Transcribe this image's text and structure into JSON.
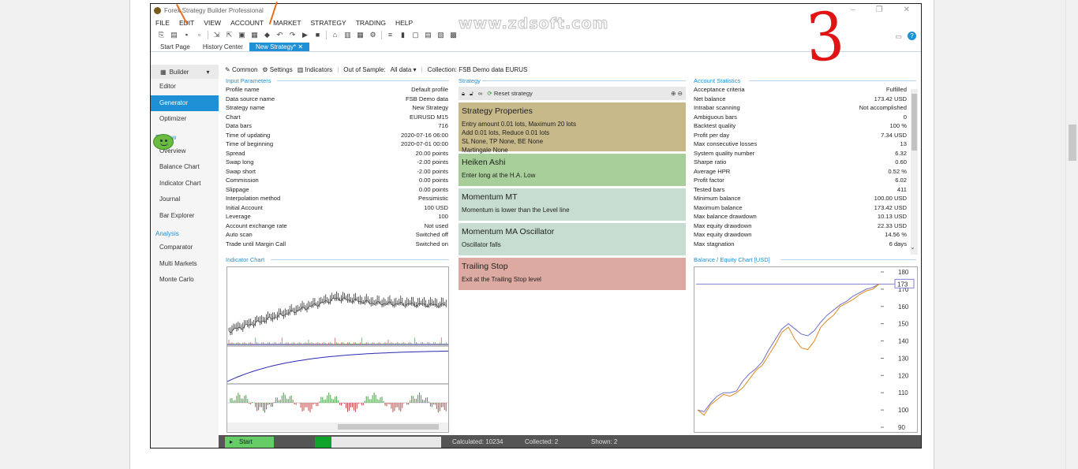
{
  "app": {
    "title": "Forex Strategy Builder Professional",
    "watermark": "www.zdsoft.com",
    "annotation_number": "3"
  },
  "menu": [
    "FILE",
    "EDIT",
    "VIEW",
    "ACCOUNT",
    "MARKET",
    "STRATEGY",
    "TRADING",
    "HELP"
  ],
  "tabs": [
    "Start Page",
    "History Center",
    "New Strategy*"
  ],
  "sidebar": {
    "builder_label": "Builder",
    "items": [
      "Editor",
      "Generator",
      "Optimizer"
    ],
    "review_label": "Review",
    "review_items": [
      "Overview",
      "Balance Chart",
      "Indicator Chart",
      "Journal",
      "Bar Explorer"
    ],
    "analysis_label": "Analysis",
    "analysis_items": [
      "Comparator",
      "Multi Markets",
      "Monte Carlo"
    ]
  },
  "subtoolbar": {
    "common": "Common",
    "settings": "Settings",
    "indicators": "Indicators",
    "oos_label": "Out of Sample:",
    "oos_value": "All data",
    "collection": "Collection:  FSB Demo data EURUS"
  },
  "input_parameters": {
    "title": "Input Parameters",
    "rows": [
      [
        "Profile name",
        "Default profile"
      ],
      [
        "Data source name",
        "FSB Demo data"
      ],
      [
        "Strategy name",
        "New Strategy"
      ],
      [
        "Chart",
        "EURUSD M15"
      ],
      [
        "Data bars",
        "716"
      ],
      [
        "Time of updating",
        "2020-07-16 06:00"
      ],
      [
        "Time of beginning",
        "2020-07-01 00:00"
      ],
      [
        "Spread",
        "20.00 points"
      ],
      [
        "Swap long",
        "-2.00 points"
      ],
      [
        "Swap short",
        "-2.00 points"
      ],
      [
        "Commission",
        "0.00 points"
      ],
      [
        "Slippage",
        "0.00 points"
      ],
      [
        "Interpolation method",
        "Pessimistic"
      ],
      [
        "Initial Account",
        "100 USD"
      ],
      [
        "Leverage",
        "100"
      ],
      [
        "Account exchange rate",
        "Not used"
      ],
      [
        "Auto scan",
        "Switched off"
      ],
      [
        "Trade until Margin Call",
        "Switched on"
      ]
    ]
  },
  "strategy": {
    "title": "Strategy",
    "reset_label": "Reset strategy",
    "blocks": [
      {
        "title": "Strategy Properties",
        "lines": [
          "Entry amount 0.01 lots, Maximum 20 lots",
          "Add 0.01 lots, Reduce 0.01 lots",
          "SL None,  TP None,  BE None",
          "Martingale None"
        ],
        "color": "#c8b98b"
      },
      {
        "title": "Heiken Ashi",
        "lines": [
          "Enter long at the H.A. Low"
        ],
        "color": "#a8cf9a"
      },
      {
        "title": "Momentum MT",
        "lines": [
          "Momentum is lower than the Level line"
        ],
        "color": "#c8ddd2"
      },
      {
        "title": "Momentum MA Oscillator",
        "lines": [
          "Oscillator falls"
        ],
        "color": "#c8ddd2"
      },
      {
        "title": "Trailing Stop",
        "lines": [
          "Exit at the Trailing Stop level"
        ],
        "color": "#dcaaa0"
      }
    ]
  },
  "account_statistics": {
    "title": "Account Statistics",
    "rows": [
      [
        "Acceptance criteria",
        "Fulfilled"
      ],
      [
        "Net balance",
        "173.42 USD"
      ],
      [
        "Intrabar scanning",
        "Not accomplished"
      ],
      [
        "Ambiguous bars",
        "0"
      ],
      [
        "Backtest quality",
        "100 %"
      ],
      [
        "Profit per day",
        "7.34 USD"
      ],
      [
        "Max consecutive losses",
        "13"
      ],
      [
        "System quality number",
        "6.32"
      ],
      [
        "Sharpe ratio",
        "0.60"
      ],
      [
        "Average HPR",
        "0.52 %"
      ],
      [
        "Profit factor",
        "6.02"
      ],
      [
        "Tested bars",
        "411"
      ],
      [
        "Minimum balance",
        "100.00 USD"
      ],
      [
        "Maximum balance",
        "173.42 USD"
      ],
      [
        "Max balance drawdown",
        "10.13 USD"
      ],
      [
        "Max equity drawdown",
        "22.33 USD"
      ],
      [
        "Max equity drawdown",
        "14.56 %"
      ],
      [
        "Max stagnation",
        "6 days"
      ]
    ]
  },
  "indicator_chart": {
    "title": "Indicator Chart"
  },
  "balance_chart": {
    "title": "Balance / Equity Chart [USD]",
    "current_label": "173"
  },
  "chart_data": {
    "type": "line",
    "title": "Balance / Equity Chart [USD]",
    "ylim": [
      90,
      180
    ],
    "yticks": [
      180,
      170,
      160,
      150,
      140,
      130,
      120,
      110,
      100,
      90
    ],
    "series": [
      {
        "name": "",
        "color": "#7070c8",
        "values": [
          100,
          99,
          104,
          108,
          110,
          110,
          111,
          117,
          121,
          124,
          128,
          135,
          141,
          147,
          150,
          147,
          144,
          143,
          146,
          151,
          155,
          158,
          161,
          163,
          166,
          168,
          170,
          171,
          173
        ]
      },
      {
        "name": "",
        "color": "#e08a20",
        "values": [
          100,
          97,
          103,
          106,
          109,
          108,
          110,
          113,
          118,
          123,
          126,
          132,
          138,
          145,
          148,
          141,
          136,
          135,
          140,
          148,
          152,
          155,
          160,
          162,
          164,
          167,
          169,
          170,
          173
        ]
      }
    ]
  },
  "status": {
    "start_label": "Start",
    "calculated": "Calculated: 10234",
    "collected": "Collected: 2",
    "shown": "Shown: 2",
    "progress": 0.13
  }
}
